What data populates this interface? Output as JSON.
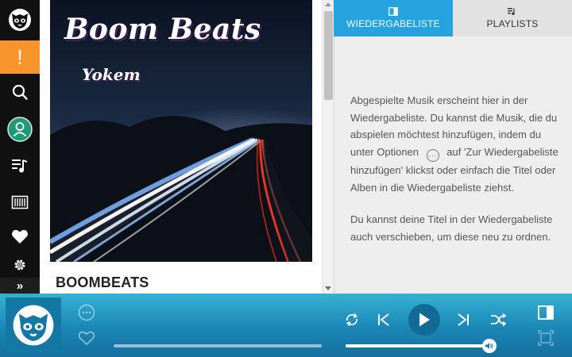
{
  "sidebar": {
    "items": [
      {
        "icon": "napster-logo-icon"
      },
      {
        "icon": "alert-icon",
        "label": "!"
      },
      {
        "icon": "search-icon"
      },
      {
        "icon": "profile-icon"
      },
      {
        "icon": "music-list-icon"
      },
      {
        "icon": "library-icon"
      },
      {
        "icon": "heart-icon"
      },
      {
        "icon": "gear-icon"
      },
      {
        "icon": "expand-icon",
        "label": "»"
      }
    ],
    "accent": "#f7952c"
  },
  "album": {
    "cover_title": "Boom Beats",
    "cover_artist": "Yokem",
    "name": "BOOMBEATS"
  },
  "tabs": [
    {
      "label": "WIEDERGABELISTE",
      "icon": "queue-icon",
      "active": true
    },
    {
      "label": "PLAYLISTS",
      "icon": "playlist-icon",
      "active": false
    }
  ],
  "queue": {
    "paragraph1_a": "Abgespielte Musik erscheint hier in der Wiedergabeliste. Du kannst die Musik, die du abspielen möchtest hinzufügen, indem du unter Optionen",
    "options_glyph": "···",
    "paragraph1_b": "auf 'Zur Wiedergabeliste hinzufügen' klickst oder einfach die Titel oder Alben in die Wiedergabeliste ziehst.",
    "paragraph2": "Du kannst deine Titel in der Wiedergabeliste auch verschieben, um diese neu zu ordnen."
  },
  "player": {
    "volume_level": 0.95,
    "colors": {
      "bar_top": "#35b2d3",
      "bar_bottom": "#166f9f",
      "accent": "#25a3df"
    }
  }
}
